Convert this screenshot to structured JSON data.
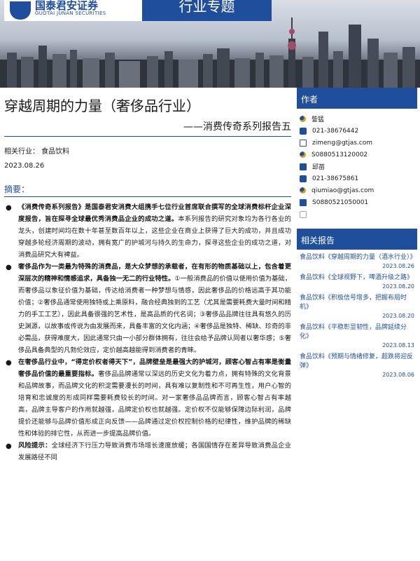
{
  "header": {
    "logo_cn": "国泰君安证券",
    "logo_en": "GUOTAI JUNAN SECURITIES",
    "report_type": "行业专题"
  },
  "report": {
    "title": "穿越周期的力量（奢侈品行业）",
    "subtitle": "——消费传奇系列报告五",
    "industry": "相关行业：  食品饮料",
    "date": "2023.08.26",
    "summary_label": "摘要："
  },
  "bullets": [
    {
      "bold": "《消费传奇系列报告》是国泰君安消费大组携手七位行业首席联合撰写的全球消费标杆企业深度报告，旨在探寻全球最优秀消费品企业的成功之道。",
      "text": "本系列报告的研究对象均为各行各业的龙头，创建时间均在数十年甚至数百年以上，这些企业在商业上获得了巨大的成功，并且成功穿越多轮经济周期的波动，拥有宽广的护城河与持久的生命力，探寻这些企业的成功之道，对消费品研究大有裨益。"
    },
    {
      "bold": "奢侈品作为一类最为特殊的消费品，是大众梦想的承载者，在有形的物质基础以上，包含着更深层次的精神和情感追求，具备独一无二的行业特性。",
      "text": "①一般消费品的价值以使用价值为基础，而奢侈品以象征价值为基础，传达给消费者一种梦想与情感，因此奢侈品的价格远高于其功能价值；②奢侈品通常使用独特或上乘原料，融合经典独到的工艺（尤其是需要耗费大量时间和精力的手工工艺），因此具备很强的艺术性，是高品质的代名词；③奢侈品品牌往往具有悠久的历史渊源，以故事或传说为由发展而来，具备丰富的文化内涵；④奢侈品是独特、稀缺、珍奇的非必需品，获得难度大，因此通常只由一小部分群体拥有，往往会给予品牌认同者以奢华感；⑤奢侈品具备典型的凡勃伦效应，定价越高越能得到消费者的青睐。"
    },
    {
      "bold": "在奢侈品行业中，“得定价权者得天下”，品牌壁垒是最强大的护城河，顾客心智占有率是衡量奢侈品价值的最重要指标。",
      "text": "奢侈品品牌通常以深远的历史文化为着力点，拥有特殊的文化背景和品牌故事，而品牌文化的积淀需要漫长的时间，具有难以复制性和不可再生性，用户心智的培育和忠诚度的形成同样需要耗费较长的时间。对一家奢侈品品牌而言，顾客心智占有率越高，品牌主导客户的作用就越强，品牌定价权也就越强。定价权不仅能够保障边际利润，品牌提价还能够与品牌价值形成正向反馈——品牌通过定价权控制价格的纪律性，维护品牌的稀缺性和体验的排它性，从而进一步提高品牌价值。"
    },
    {
      "bold": "风险提示：",
      "text": "全球经济下行压力导致消费市场增长速度放缓；各国国情存在差异导致消费品企业发展路径不同"
    }
  ],
  "sidebar": {
    "authors_label": "作者",
    "authors": [
      {
        "icon": "person-icon",
        "text": "訾猛"
      },
      {
        "icon": "phone-icon",
        "text": "021-38676442"
      },
      {
        "icon": "mail-icon",
        "text": "zimeng@gtjas.com"
      },
      {
        "icon": "person-icon",
        "text": "S0880513120002"
      },
      {
        "icon": "id-icon",
        "text": "邱苗"
      },
      {
        "icon": "phone-icon",
        "text": "021-38675861"
      },
      {
        "icon": "person-icon",
        "text": "qiumiao@gtjas.com"
      },
      {
        "icon": "id-icon",
        "text": "S0880521050001"
      }
    ],
    "related_label": "相关报告",
    "related": [
      {
        "title": "食品饮料《穿越周期的力量（酒水行业）》",
        "date": "2023.08.26"
      },
      {
        "title": "食品饮料《全球视野下，啤酒升级之路》",
        "date": "2023.08.20"
      },
      {
        "title": "食品饮料《积极信号增多，把握布局时机》",
        "date": "2023.08.20"
      },
      {
        "title": "食品饮料《平稳彰显韧性，品牌延续分化》",
        "date": "2023.08.13"
      },
      {
        "title": "食品饮料《预期与情绪修复，超跌将迎反弹》",
        "date": "2023.08.06"
      }
    ]
  }
}
